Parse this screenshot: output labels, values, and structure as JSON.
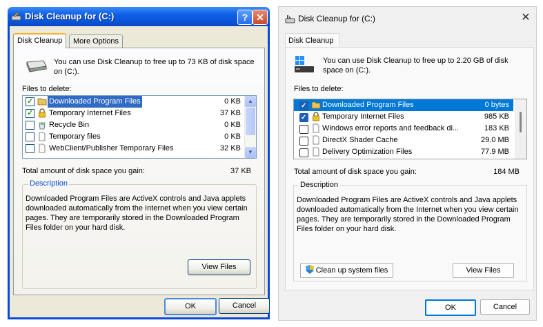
{
  "xp": {
    "title": "Disk Cleanup for  (C:)",
    "help_label": "?",
    "close_label": "✕",
    "tabs": [
      "Disk Cleanup",
      "More Options"
    ],
    "intro": "You can use Disk Cleanup to free up to 73 KB of disk space on  (C:).",
    "files_label": "Files to delete:",
    "files": [
      {
        "name": "Downloaded Program Files",
        "size": "0 KB",
        "checked": true,
        "selected": true,
        "icon": "folder-icon"
      },
      {
        "name": "Temporary Internet Files",
        "size": "37 KB",
        "checked": true,
        "selected": false,
        "icon": "lock-icon"
      },
      {
        "name": "Recycle Bin",
        "size": "0 KB",
        "checked": false,
        "selected": false,
        "icon": "recycle-bin-icon"
      },
      {
        "name": "Temporary files",
        "size": "0 KB",
        "checked": false,
        "selected": false,
        "icon": "document-icon"
      },
      {
        "name": "WebClient/Publisher Temporary Files",
        "size": "32 KB",
        "checked": false,
        "selected": false,
        "icon": "document-icon"
      }
    ],
    "total_label": "Total amount of disk space you gain:",
    "total_value": "37 KB",
    "description_label": "Description",
    "description_text": "Downloaded Program Files are ActiveX controls and Java applets downloaded automatically from the Internet when you view certain pages. They are temporarily stored in the Downloaded Program Files folder on your hard disk.",
    "view_files_label": "View Files",
    "ok_label": "OK",
    "cancel_label": "Cancel"
  },
  "w11": {
    "title": "Disk Cleanup for  (C:)",
    "close_label": "✕",
    "tab": "Disk Cleanup",
    "intro": "You can use Disk Cleanup to free up to 2.20 GB of disk space on  (C:).",
    "files_label": "Files to delete:",
    "files": [
      {
        "name": "Downloaded Program Files",
        "size": "0 bytes",
        "checked": true,
        "selected": true,
        "icon": "folder-icon"
      },
      {
        "name": "Temporary Internet Files",
        "size": "985 KB",
        "checked": true,
        "selected": false,
        "icon": "lock-icon"
      },
      {
        "name": "Windows error reports and feedback di...",
        "size": "183 KB",
        "checked": false,
        "selected": false,
        "icon": "document-icon"
      },
      {
        "name": "DirectX Shader Cache",
        "size": "29.0 MB",
        "checked": false,
        "selected": false,
        "icon": "document-icon"
      },
      {
        "name": "Delivery Optimization Files",
        "size": "77.9 MB",
        "checked": false,
        "selected": false,
        "icon": "document-icon"
      }
    ],
    "total_label": "Total amount of disk space you gain:",
    "total_value": "184 MB",
    "description_label": "Description",
    "description_text": "Downloaded Program Files are ActiveX controls and Java applets downloaded automatically from the Internet when you view certain pages. They are temporarily stored in the Downloaded Program Files folder on your hard disk.",
    "cleanup_label": "Clean up system files",
    "view_files_label": "View Files",
    "ok_label": "OK",
    "cancel_label": "Cancel"
  }
}
